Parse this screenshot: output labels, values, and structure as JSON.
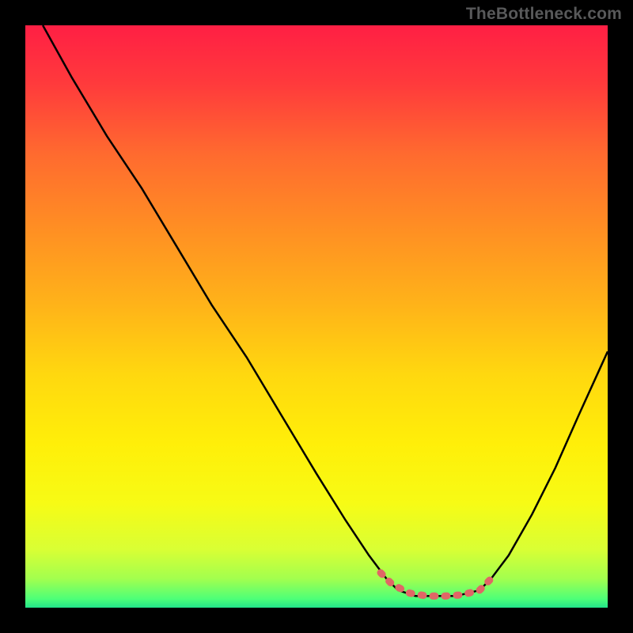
{
  "watermark": "TheBottleneck.com",
  "colors": {
    "frame": "#000000",
    "curve": "#000000",
    "marker": "#e06666",
    "gradient_stops": [
      {
        "offset": 0.0,
        "color": "#ff1f44"
      },
      {
        "offset": 0.1,
        "color": "#ff3a3c"
      },
      {
        "offset": 0.22,
        "color": "#ff6a2f"
      },
      {
        "offset": 0.35,
        "color": "#ff8f23"
      },
      {
        "offset": 0.48,
        "color": "#ffb319"
      },
      {
        "offset": 0.6,
        "color": "#ffd80f"
      },
      {
        "offset": 0.72,
        "color": "#ffef09"
      },
      {
        "offset": 0.82,
        "color": "#f7fb15"
      },
      {
        "offset": 0.9,
        "color": "#d9ff34"
      },
      {
        "offset": 0.95,
        "color": "#a3ff4e"
      },
      {
        "offset": 0.985,
        "color": "#4dff78"
      },
      {
        "offset": 1.0,
        "color": "#22e38a"
      }
    ]
  },
  "chart_data": {
    "type": "line",
    "title": "",
    "xlabel": "",
    "ylabel": "",
    "xlim": [
      0,
      100
    ],
    "ylim": [
      0,
      100
    ],
    "series": [
      {
        "name": "bottleneck-curve",
        "x": [
          3,
          8,
          14,
          20,
          26,
          32,
          38,
          44,
          50,
          55,
          59,
          62,
          64,
          67,
          70,
          74,
          78,
          80,
          83,
          87,
          91,
          95,
          100
        ],
        "y": [
          100,
          91,
          81,
          72,
          62,
          52,
          43,
          33,
          23,
          15,
          9,
          5,
          3,
          2,
          2,
          2,
          3,
          5,
          9,
          16,
          24,
          33,
          44
        ]
      }
    ],
    "marker": {
      "name": "optimal-zone",
      "x": [
        61,
        63,
        66,
        69,
        72,
        75,
        78,
        80
      ],
      "y": [
        6,
        4,
        2.5,
        2,
        2,
        2.2,
        3,
        5
      ]
    },
    "marker_stroke_width_px": 9
  }
}
